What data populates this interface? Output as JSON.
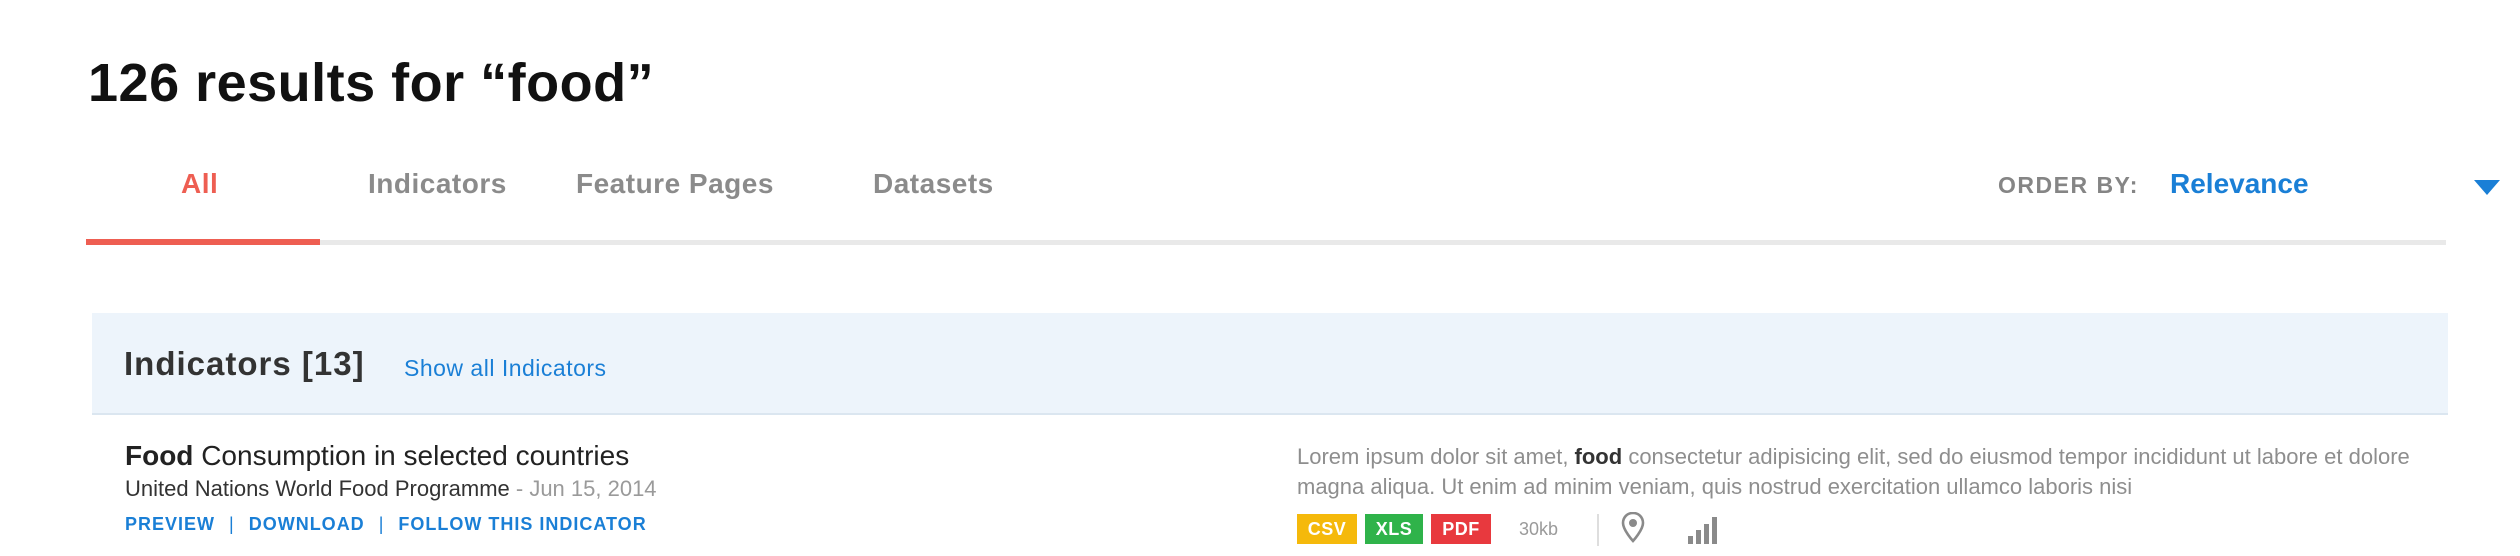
{
  "page": {
    "title": "126 results for “food”"
  },
  "tabs": [
    {
      "label": "All",
      "active": true
    },
    {
      "label": "Indicators",
      "active": false
    },
    {
      "label": "Feature Pages",
      "active": false
    },
    {
      "label": "Datasets",
      "active": false
    }
  ],
  "order_by": {
    "label": "ORDER BY:",
    "value": "Relevance",
    "icon": "caret-down-icon"
  },
  "section": {
    "title": "Indicators [13]",
    "link": "Show all Indicators"
  },
  "result": {
    "title_highlight": "Food",
    "title_rest": " Consumption in selected countries",
    "source": "United Nations World Food Programme",
    "date": " - Jun 15, 2014",
    "actions": [
      "PREVIEW",
      "DOWNLOAD",
      "FOLLOW THIS INDICATOR"
    ],
    "action_separator": "|",
    "desc_before": "Lorem ipsum dolor sit amet, ",
    "desc_highlight": "food",
    "desc_after": " consectetur adipisicing elit, sed do eiusmod tempor incididunt ut labore et dolore magna aliqua. Ut enim ad minim veniam, quis nostrud exercitation ullamco laboris nisi",
    "formats": [
      {
        "label": "CSV",
        "color": "#f5b90b"
      },
      {
        "label": "XLS",
        "color": "#2fb34a"
      },
      {
        "label": "PDF",
        "color": "#e8393e"
      }
    ],
    "filesize": "30kb",
    "icons": [
      "map-pin-icon",
      "bar-chart-icon"
    ]
  },
  "colors": {
    "accent": "#ee5e52",
    "link": "#1a7fd6",
    "section_bg": "#edf4fb"
  }
}
